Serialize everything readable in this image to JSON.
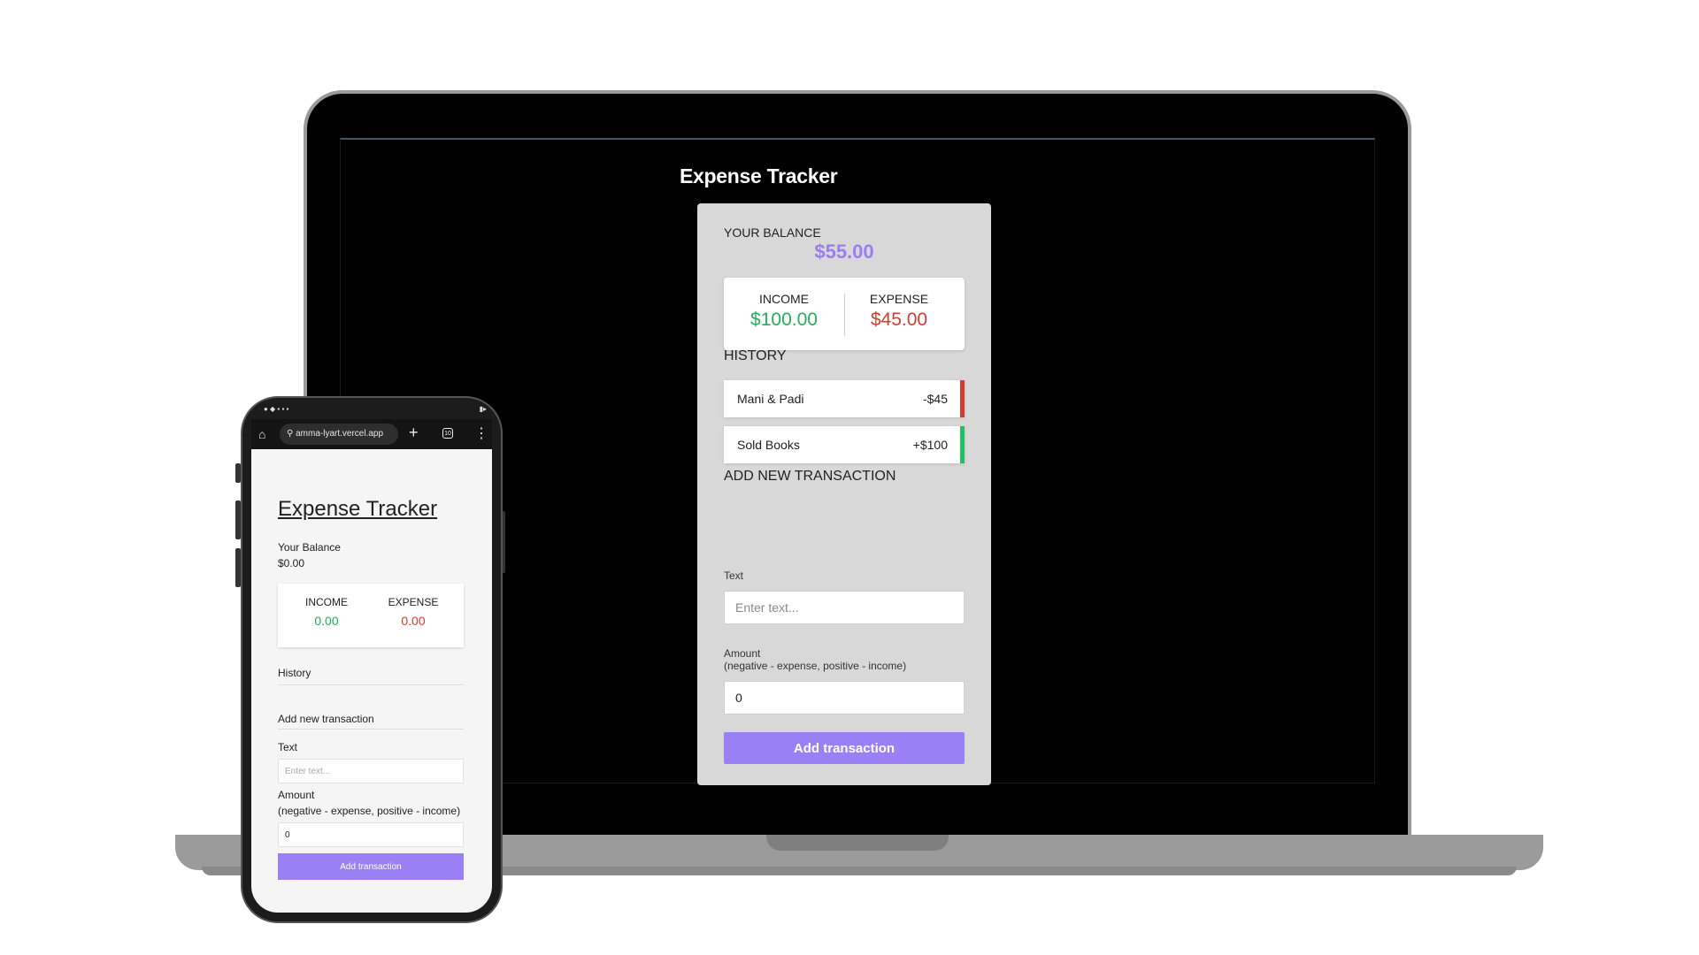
{
  "desktop": {
    "title": "Expense Tracker",
    "balance_label": "YOUR BALANCE",
    "balance": "$55.00",
    "income_label": "INCOME",
    "income": "$100.00",
    "expense_label": "EXPENSE",
    "expense": "$45.00",
    "history_heading": "HISTORY",
    "history": [
      {
        "text": "Mani & Padi",
        "amount": "-$45",
        "type": "minus"
      },
      {
        "text": "Sold Books",
        "amount": "+$100",
        "type": "plus"
      }
    ],
    "add_heading": "ADD NEW TRANSACTION",
    "text_label": "Text",
    "text_placeholder": "Enter text...",
    "amount_label": "Amount",
    "amount_hint": "(negative - expense, positive - income)",
    "amount_value": "0",
    "button_label": "Add transaction"
  },
  "phone": {
    "url": "amma-lyart.vercel.app",
    "tab_count": "10",
    "title": "Expense Tracker",
    "balance_label": "Your Balance",
    "balance": "$0.00",
    "income_label": "INCOME",
    "income": "0.00",
    "expense_label": "EXPENSE",
    "expense": "0.00",
    "history_heading": "History",
    "add_heading": "Add new transaction",
    "text_label": "Text",
    "text_placeholder": "Enter text...",
    "amount_label": "Amount",
    "amount_hint": "(negative - expense, positive - income)",
    "amount_value": "0",
    "button_label": "Add transaction"
  },
  "colors": {
    "accent": "#9b80f5",
    "balance": "#9a7df2",
    "income": "#21b057",
    "expense": "#d83b2c"
  }
}
